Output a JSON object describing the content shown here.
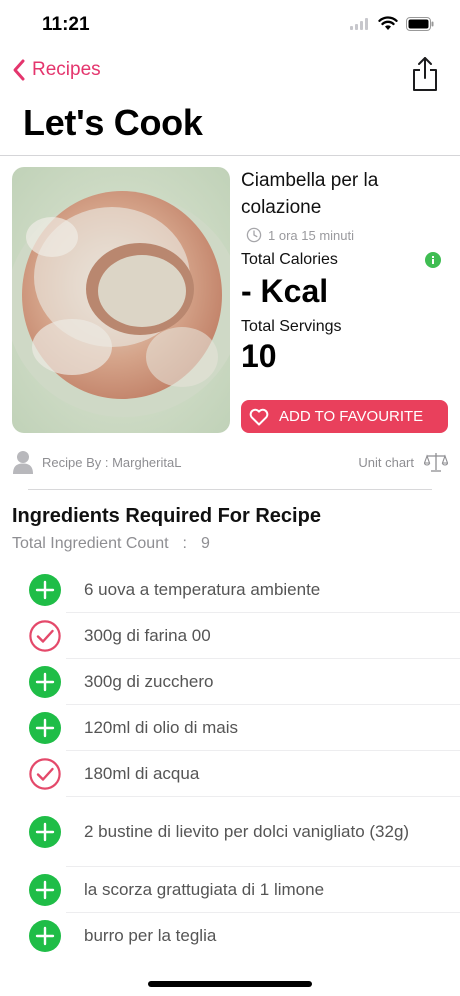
{
  "status": {
    "time": "11:21"
  },
  "nav": {
    "back_label": "Recipes"
  },
  "page": {
    "title": "Let's Cook"
  },
  "recipe": {
    "name": "Ciambella per la colazione",
    "cook_time": "1 ora 15 minuti",
    "calories_label": "Total Calories",
    "calories_value": "- Kcal",
    "servings_label": "Total Servings",
    "servings_value": "10",
    "favourite_label": "ADD TO FAVOURITE",
    "author": "Recipe By : MargheritaL",
    "unit_chart_label": "Unit chart"
  },
  "ingredients": {
    "title": "Ingredients Required For Recipe",
    "count_label": "Total Ingredient Count",
    "count_sep": ":",
    "count_value": "9",
    "items": [
      {
        "text": "6 uova a temperatura ambiente",
        "state": "add"
      },
      {
        "text": "300g di farina 00",
        "state": "checked"
      },
      {
        "text": "300g di zucchero",
        "state": "add"
      },
      {
        "text": "120ml di olio di mais",
        "state": "add"
      },
      {
        "text": "180ml di acqua",
        "state": "checked"
      },
      {
        "text": "2 bustine di lievito per dolci vanigliato (32g)",
        "state": "add"
      },
      {
        "text": "la scorza grattugiata di 1 limone",
        "state": "add"
      },
      {
        "text": "burro per la teglia",
        "state": "add"
      }
    ]
  },
  "colors": {
    "accent": "#e4356d",
    "favourite_bg": "#e9405c",
    "add_green": "#1fbd47",
    "checked_red": "#e4496a",
    "info_green": "#3fbd52"
  }
}
